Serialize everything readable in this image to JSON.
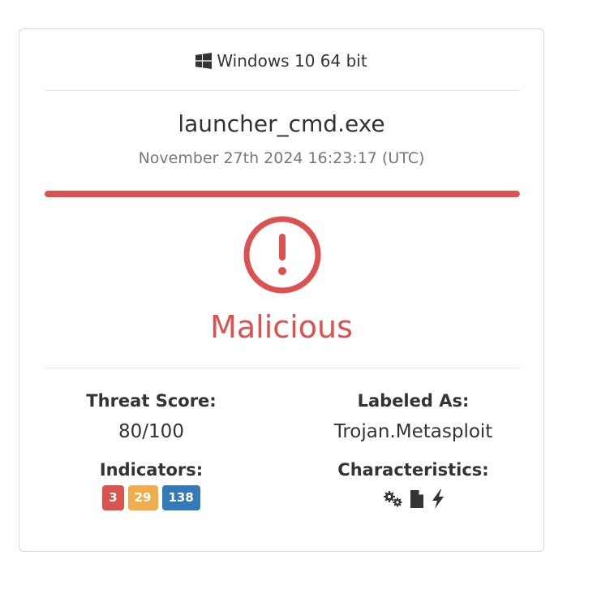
{
  "os": {
    "icon": "windows-icon",
    "label": "Windows 10 64 bit"
  },
  "file": {
    "name": "launcher_cmd.exe",
    "timestamp": "November 27th 2024 16:23:17 (UTC)"
  },
  "threat_bar": {
    "fill_percent": 100,
    "color": "#dd5151"
  },
  "verdict": {
    "icon": "exclamation-circle-icon",
    "label": "Malicious",
    "color": "#dd5151"
  },
  "threat_score": {
    "label": "Threat Score:",
    "value": "80/100"
  },
  "labeled_as": {
    "label": "Labeled As:",
    "value": "Trojan.Metasploit"
  },
  "indicators": {
    "label": "Indicators:",
    "malicious": "3",
    "suspicious": "29",
    "informative": "138",
    "colors": {
      "malicious": "#d9534f",
      "suspicious": "#f0ad4e",
      "informative": "#337ab7"
    }
  },
  "characteristics": {
    "label": "Characteristics:",
    "icons": [
      "gears-icon",
      "file-icon",
      "bolt-icon"
    ]
  }
}
